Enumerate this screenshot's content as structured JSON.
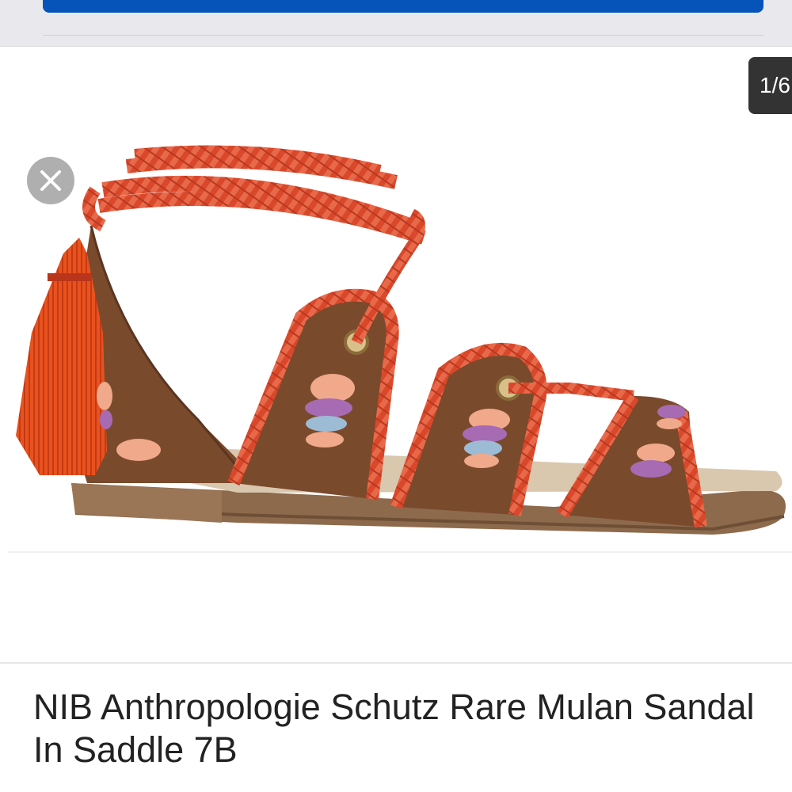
{
  "gallery": {
    "counter": "1/6",
    "product_image_alt": "Sandal with red braided lace-up straps, tassel and embroidered flowers on saddle brown leather"
  },
  "product": {
    "title": "NIB Anthropologie Schutz Rare Mulan Sandal In Saddle 7B"
  },
  "icons": {
    "close": "close-icon"
  },
  "colors": {
    "primary_button": "#0654ba",
    "counter_bg": "#333333",
    "close_bg": "#a9a9a9"
  }
}
